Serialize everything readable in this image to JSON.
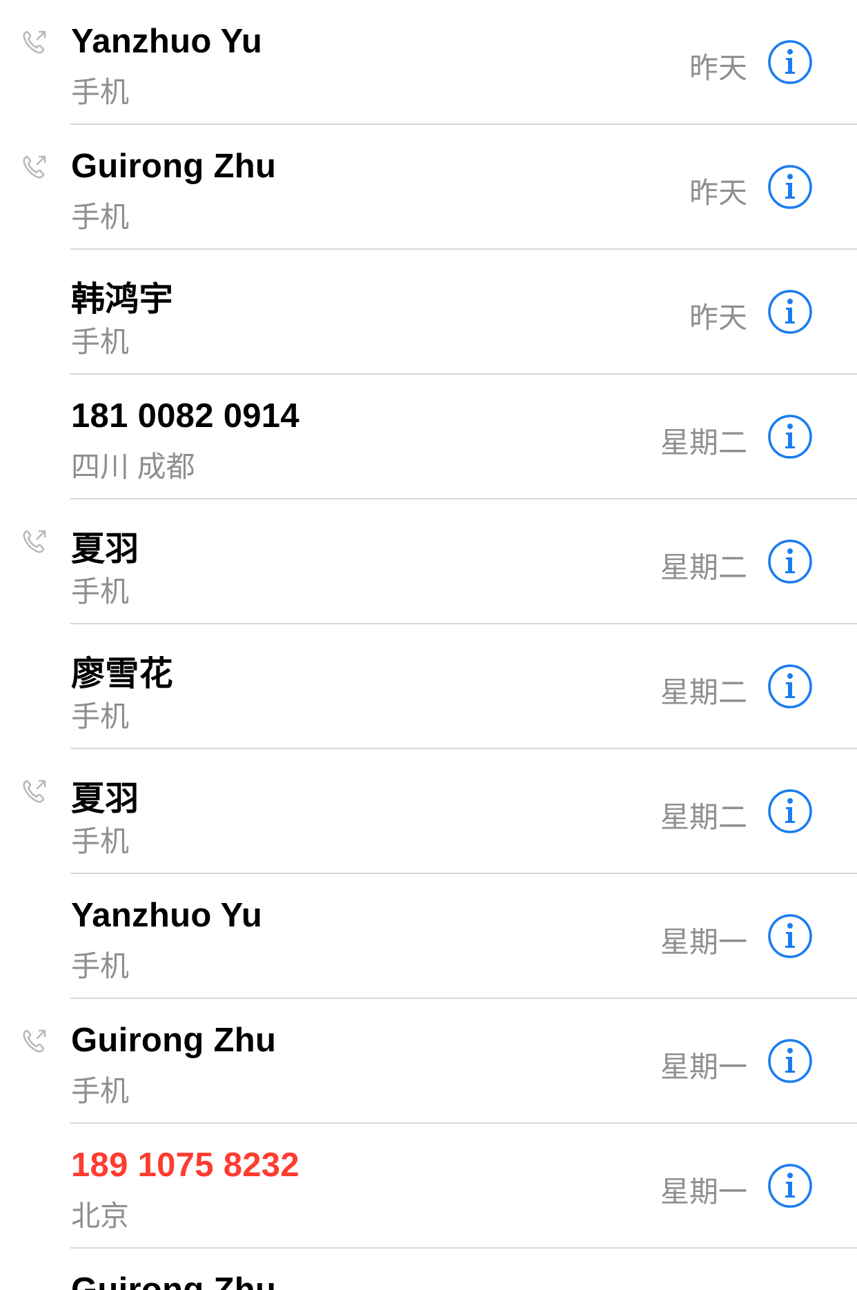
{
  "colors": {
    "accent": "#1a7cf0",
    "missed": "#ff3b30",
    "secondary_text": "#8e8e93",
    "divider": "#d7d7db",
    "outgoing_icon": "#b8b8bd"
  },
  "calls": [
    {
      "name": "Yanzhuo Yu",
      "subtitle": "手机",
      "time": "昨天",
      "outgoing": true,
      "missed": false,
      "info_icon": "info-circle-icon"
    },
    {
      "name": "Guirong Zhu",
      "subtitle": "手机",
      "time": "昨天",
      "outgoing": true,
      "missed": false,
      "info_icon": "info-circle-icon"
    },
    {
      "name": "韩鸿宇",
      "subtitle": "手机",
      "time": "昨天",
      "outgoing": false,
      "missed": false,
      "info_icon": "info-circle-icon"
    },
    {
      "name": "181 0082 0914",
      "subtitle": "四川 成都",
      "time": "星期二",
      "outgoing": false,
      "missed": false,
      "info_icon": "info-circle-icon"
    },
    {
      "name": "夏羽",
      "subtitle": "手机",
      "time": "星期二",
      "outgoing": true,
      "missed": false,
      "info_icon": "info-circle-icon"
    },
    {
      "name": "廖雪花",
      "subtitle": "手机",
      "time": "星期二",
      "outgoing": false,
      "missed": false,
      "info_icon": "info-circle-icon"
    },
    {
      "name": "夏羽",
      "subtitle": "手机",
      "time": "星期二",
      "outgoing": true,
      "missed": false,
      "info_icon": "info-circle-icon"
    },
    {
      "name": "Yanzhuo Yu",
      "subtitle": "手机",
      "time": "星期一",
      "outgoing": false,
      "missed": false,
      "info_icon": "info-circle-icon"
    },
    {
      "name": "Guirong Zhu",
      "subtitle": "手机",
      "time": "星期一",
      "outgoing": true,
      "missed": false,
      "info_icon": "info-circle-icon"
    },
    {
      "name": "189 1075 8232",
      "subtitle": "北京",
      "time": "星期一",
      "outgoing": false,
      "missed": true,
      "info_icon": "info-circle-icon"
    }
  ],
  "partial_call": {
    "name": "Guirong Zhu"
  }
}
